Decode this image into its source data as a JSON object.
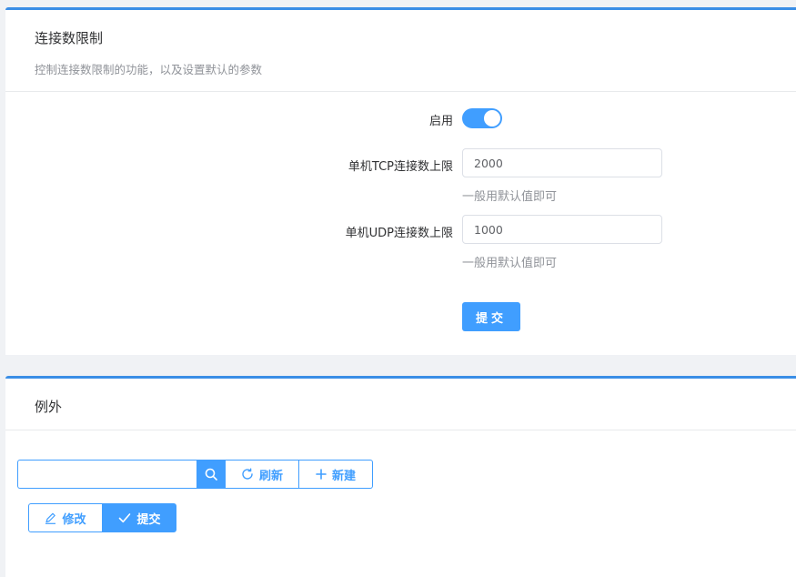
{
  "section1": {
    "title": "连接数限制",
    "description": "控制连接数限制的功能，以及设置默认的参数",
    "enable_label": "启用",
    "enable_on": true,
    "tcp_label": "单机TCP连接数上限",
    "tcp_value": "2000",
    "tcp_hint": "一般用默认值即可",
    "udp_label": "单机UDP连接数上限",
    "udp_value": "1000",
    "udp_hint": "一般用默认值即可",
    "submit_label": "提交"
  },
  "section2": {
    "title": "例外",
    "search_value": "",
    "refresh_label": "刷新",
    "new_label": "新建",
    "edit_label": "修改",
    "submit_label": "提交"
  },
  "icons": {
    "search": "search-icon",
    "refresh": "refresh-icon",
    "plus": "plus-icon",
    "edit": "pencil-icon",
    "check": "check-icon"
  },
  "colors": {
    "primary": "#409eff",
    "header_border": "#3a8ee6",
    "background": "#f0f2f5"
  }
}
